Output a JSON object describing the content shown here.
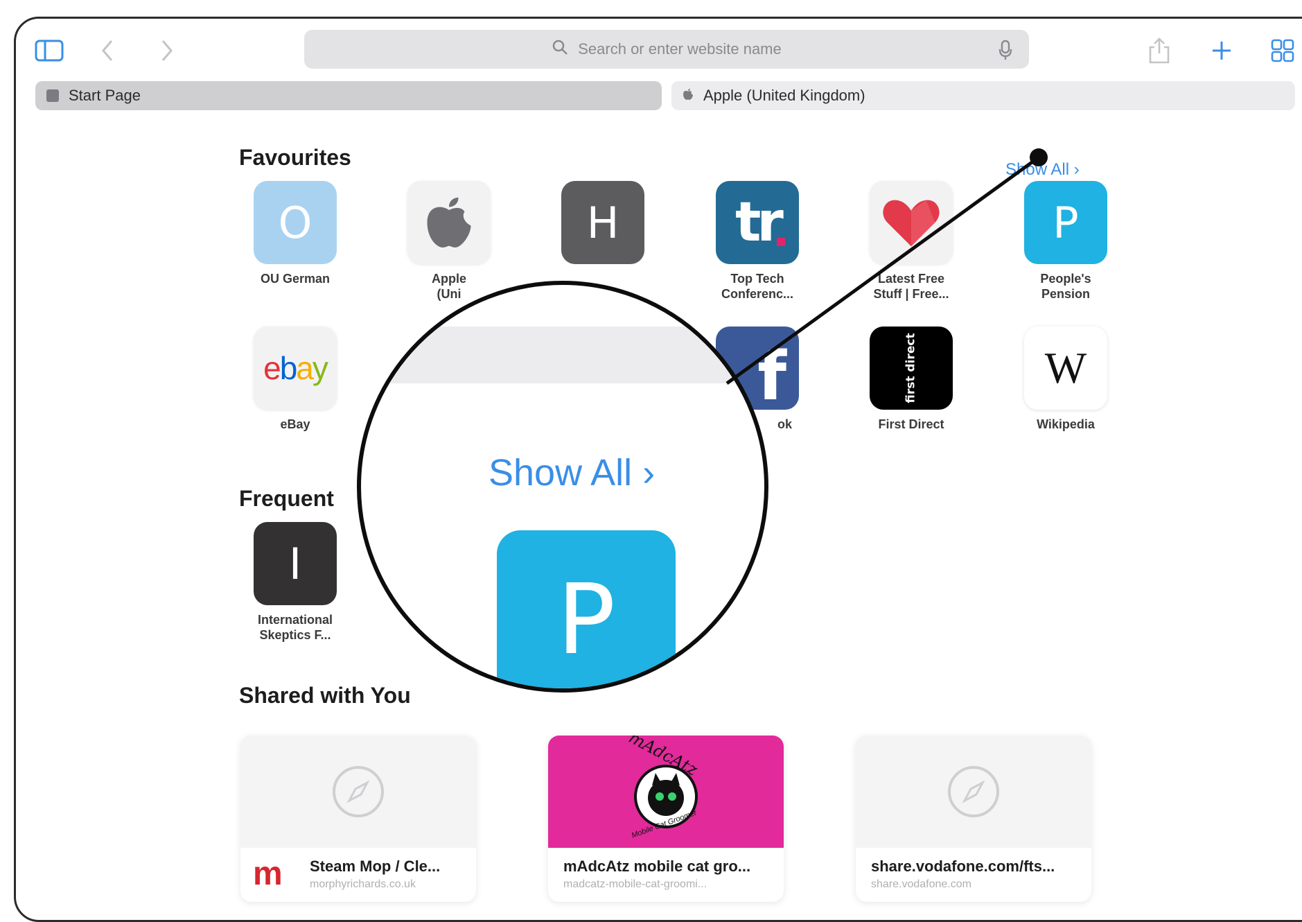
{
  "toolbar": {
    "search_placeholder": "Search or enter website name",
    "sidebar_icon": "sidebar-icon",
    "back_icon": "chevron-left-icon",
    "forward_icon": "chevron-right-icon",
    "share_icon": "share-icon",
    "new_tab_icon": "plus-icon",
    "tab_overview_icon": "grid-icon"
  },
  "tabs": [
    {
      "label": "Start Page",
      "active": true
    },
    {
      "label": "Apple (United Kingdom)",
      "active": false
    }
  ],
  "favourites": {
    "title": "Favourites",
    "show_all": "Show All",
    "items": [
      {
        "glyph": "O",
        "label_line1": "OU German",
        "label_line2": "",
        "color": "#a9d2f0"
      },
      {
        "glyph": "",
        "label_line1": "Apple",
        "label_line2": "(Uni",
        "color": "#f2f2f3",
        "icon": "apple-logo-icon"
      },
      {
        "glyph": "H",
        "label_line1": "",
        "label_line2": "",
        "color": "#5c5c5e"
      },
      {
        "glyph": "tr",
        "label_line1": "Top Tech",
        "label_line2": "Conferenc...",
        "color": "#236b94"
      },
      {
        "glyph": "",
        "label_line1": "Latest Free",
        "label_line2": "Stuff | Free...",
        "color": "#f2f2f3",
        "icon": "heart-icon"
      },
      {
        "glyph": "P",
        "label_line1": "People's",
        "label_line2": "Pension",
        "color": "#1fb2e2"
      },
      {
        "glyph": "ebay",
        "label_line1": "eBay",
        "label_line2": "",
        "color": "#f2f2f3"
      },
      {
        "glyph": "f",
        "label_line1": "ok",
        "label_line2": "",
        "color": "#3b5998"
      },
      {
        "glyph": "first direct",
        "label_line1": "First Direct",
        "label_line2": "",
        "color": "#000000"
      },
      {
        "glyph": "W",
        "label_line1": "Wikipedia",
        "label_line2": "",
        "color": "#ffffff"
      }
    ]
  },
  "frequent": {
    "title": "Frequent",
    "items": [
      {
        "glyph": "I",
        "label_line1": "International",
        "label_line2": "Skeptics F...",
        "color": "#333131"
      }
    ]
  },
  "shared": {
    "title": "Shared with You",
    "items": [
      {
        "title": "Steam Mop / Cle...",
        "url": "morphyrichards.co.uk",
        "thumb": "compass-icon",
        "badge": "m"
      },
      {
        "title": "mAdcAtz mobile cat gro...",
        "url": "madcatz-mobile-cat-groomi...",
        "thumb": "madcatz-logo",
        "thumb_text": "mAdcAtz",
        "thumb_subtext": "Mobile Cat Groomer"
      },
      {
        "title": "share.vodafone.com/fts...",
        "url": "share.vodafone.com",
        "thumb": "compass-icon"
      }
    ]
  },
  "magnifier": {
    "show_all": "Show All",
    "tile_glyph": "P"
  },
  "colors": {
    "accent": "#3a8ee6",
    "people_pension": "#1fb2e2",
    "madcatz_pink": "#e22a9b"
  }
}
